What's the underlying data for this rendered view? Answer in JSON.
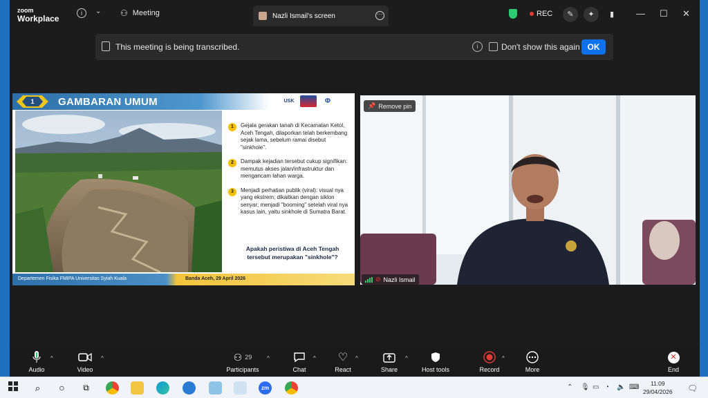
{
  "titlebar": {
    "brand_line1": "zoom",
    "brand_line2": "Workplace",
    "meeting_label": "Meeting",
    "screen_tab_label": "Nazli Ismail's screen",
    "rec_label": "REC"
  },
  "banner": {
    "message": "This meeting is being transcribed.",
    "dont_show_label": "Don't show this again",
    "ok_label": "OK"
  },
  "slide": {
    "number": "1",
    "title": "GAMBARAN UMUM",
    "logo_labels": [
      "USK",
      "",
      "Φ"
    ],
    "bullets": [
      {
        "num": "1",
        "text": "Gejala gerakan tanah di Kecamatan Ketol, Aceh Tengah, dilaporkan telah berkembang sejak lama, sebelum ramai disebut \"sinkhole\"."
      },
      {
        "num": "2",
        "text": "Dampak kejadian tersebut cukup signifikan: memutus akses jalan/infrastruktur dan mengancam lahan warga."
      },
      {
        "num": "3",
        "text": "Menjadi perhatian publik (viral): visual nya yang ekstrem; dikaitkan dengan siklon senyar; menjadi \"booming\" setelah viral nya kasus lain, yaitu sinkhole di Sumatra Barat."
      }
    ],
    "question": "Apakah peristiwa di Aceh Tengah tersebut merupakan \"sinkhole\"?",
    "footer_left": "Departemen Fisika FMIPA Universitas Syiah Kuala",
    "footer_right": "Banda Aceh, 29 April 2026"
  },
  "video": {
    "remove_pin_label": "Remove pin",
    "participant_name": "Nazli Ismail"
  },
  "toolbar": {
    "audio": "Audio",
    "video": "Video",
    "participants": "Participants",
    "participants_count": "29",
    "chat": "Chat",
    "react": "React",
    "share": "Share",
    "host_tools": "Host tools",
    "record": "Record",
    "more": "More",
    "end": "End"
  },
  "taskbar": {
    "time": "11:09",
    "date": "29/04/2026",
    "zoom_icon_label": "zm"
  },
  "colors": {
    "zoom_blue": "#0e72ed",
    "rec_red": "#e53935",
    "shield_green": "#2ecc71",
    "slide_blue": "#2d6fa8",
    "slide_yellow": "#f5c000"
  }
}
